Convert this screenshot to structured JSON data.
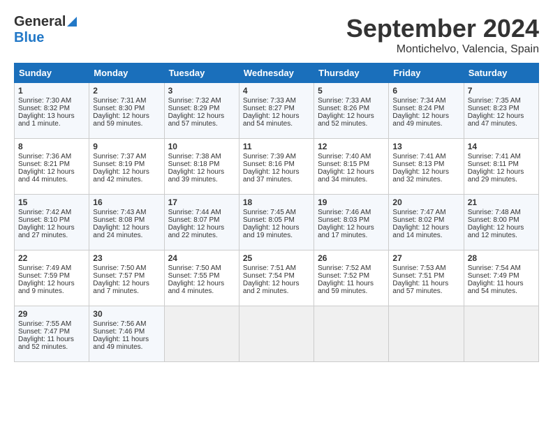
{
  "header": {
    "logo_general": "General",
    "logo_blue": "Blue",
    "month": "September 2024",
    "location": "Montichelvo, Valencia, Spain"
  },
  "weekdays": [
    "Sunday",
    "Monday",
    "Tuesday",
    "Wednesday",
    "Thursday",
    "Friday",
    "Saturday"
  ],
  "weeks": [
    [
      {
        "day": "1",
        "lines": [
          "Sunrise: 7:30 AM",
          "Sunset: 8:32 PM",
          "Daylight: 13 hours",
          "and 1 minute."
        ]
      },
      {
        "day": "2",
        "lines": [
          "Sunrise: 7:31 AM",
          "Sunset: 8:30 PM",
          "Daylight: 12 hours",
          "and 59 minutes."
        ]
      },
      {
        "day": "3",
        "lines": [
          "Sunrise: 7:32 AM",
          "Sunset: 8:29 PM",
          "Daylight: 12 hours",
          "and 57 minutes."
        ]
      },
      {
        "day": "4",
        "lines": [
          "Sunrise: 7:33 AM",
          "Sunset: 8:27 PM",
          "Daylight: 12 hours",
          "and 54 minutes."
        ]
      },
      {
        "day": "5",
        "lines": [
          "Sunrise: 7:33 AM",
          "Sunset: 8:26 PM",
          "Daylight: 12 hours",
          "and 52 minutes."
        ]
      },
      {
        "day": "6",
        "lines": [
          "Sunrise: 7:34 AM",
          "Sunset: 8:24 PM",
          "Daylight: 12 hours",
          "and 49 minutes."
        ]
      },
      {
        "day": "7",
        "lines": [
          "Sunrise: 7:35 AM",
          "Sunset: 8:23 PM",
          "Daylight: 12 hours",
          "and 47 minutes."
        ]
      }
    ],
    [
      {
        "day": "8",
        "lines": [
          "Sunrise: 7:36 AM",
          "Sunset: 8:21 PM",
          "Daylight: 12 hours",
          "and 44 minutes."
        ]
      },
      {
        "day": "9",
        "lines": [
          "Sunrise: 7:37 AM",
          "Sunset: 8:19 PM",
          "Daylight: 12 hours",
          "and 42 minutes."
        ]
      },
      {
        "day": "10",
        "lines": [
          "Sunrise: 7:38 AM",
          "Sunset: 8:18 PM",
          "Daylight: 12 hours",
          "and 39 minutes."
        ]
      },
      {
        "day": "11",
        "lines": [
          "Sunrise: 7:39 AM",
          "Sunset: 8:16 PM",
          "Daylight: 12 hours",
          "and 37 minutes."
        ]
      },
      {
        "day": "12",
        "lines": [
          "Sunrise: 7:40 AM",
          "Sunset: 8:15 PM",
          "Daylight: 12 hours",
          "and 34 minutes."
        ]
      },
      {
        "day": "13",
        "lines": [
          "Sunrise: 7:41 AM",
          "Sunset: 8:13 PM",
          "Daylight: 12 hours",
          "and 32 minutes."
        ]
      },
      {
        "day": "14",
        "lines": [
          "Sunrise: 7:41 AM",
          "Sunset: 8:11 PM",
          "Daylight: 12 hours",
          "and 29 minutes."
        ]
      }
    ],
    [
      {
        "day": "15",
        "lines": [
          "Sunrise: 7:42 AM",
          "Sunset: 8:10 PM",
          "Daylight: 12 hours",
          "and 27 minutes."
        ]
      },
      {
        "day": "16",
        "lines": [
          "Sunrise: 7:43 AM",
          "Sunset: 8:08 PM",
          "Daylight: 12 hours",
          "and 24 minutes."
        ]
      },
      {
        "day": "17",
        "lines": [
          "Sunrise: 7:44 AM",
          "Sunset: 8:07 PM",
          "Daylight: 12 hours",
          "and 22 minutes."
        ]
      },
      {
        "day": "18",
        "lines": [
          "Sunrise: 7:45 AM",
          "Sunset: 8:05 PM",
          "Daylight: 12 hours",
          "and 19 minutes."
        ]
      },
      {
        "day": "19",
        "lines": [
          "Sunrise: 7:46 AM",
          "Sunset: 8:03 PM",
          "Daylight: 12 hours",
          "and 17 minutes."
        ]
      },
      {
        "day": "20",
        "lines": [
          "Sunrise: 7:47 AM",
          "Sunset: 8:02 PM",
          "Daylight: 12 hours",
          "and 14 minutes."
        ]
      },
      {
        "day": "21",
        "lines": [
          "Sunrise: 7:48 AM",
          "Sunset: 8:00 PM",
          "Daylight: 12 hours",
          "and 12 minutes."
        ]
      }
    ],
    [
      {
        "day": "22",
        "lines": [
          "Sunrise: 7:49 AM",
          "Sunset: 7:59 PM",
          "Daylight: 12 hours",
          "and 9 minutes."
        ]
      },
      {
        "day": "23",
        "lines": [
          "Sunrise: 7:50 AM",
          "Sunset: 7:57 PM",
          "Daylight: 12 hours",
          "and 7 minutes."
        ]
      },
      {
        "day": "24",
        "lines": [
          "Sunrise: 7:50 AM",
          "Sunset: 7:55 PM",
          "Daylight: 12 hours",
          "and 4 minutes."
        ]
      },
      {
        "day": "25",
        "lines": [
          "Sunrise: 7:51 AM",
          "Sunset: 7:54 PM",
          "Daylight: 12 hours",
          "and 2 minutes."
        ]
      },
      {
        "day": "26",
        "lines": [
          "Sunrise: 7:52 AM",
          "Sunset: 7:52 PM",
          "Daylight: 11 hours",
          "and 59 minutes."
        ]
      },
      {
        "day": "27",
        "lines": [
          "Sunrise: 7:53 AM",
          "Sunset: 7:51 PM",
          "Daylight: 11 hours",
          "and 57 minutes."
        ]
      },
      {
        "day": "28",
        "lines": [
          "Sunrise: 7:54 AM",
          "Sunset: 7:49 PM",
          "Daylight: 11 hours",
          "and 54 minutes."
        ]
      }
    ],
    [
      {
        "day": "29",
        "lines": [
          "Sunrise: 7:55 AM",
          "Sunset: 7:47 PM",
          "Daylight: 11 hours",
          "and 52 minutes."
        ]
      },
      {
        "day": "30",
        "lines": [
          "Sunrise: 7:56 AM",
          "Sunset: 7:46 PM",
          "Daylight: 11 hours",
          "and 49 minutes."
        ]
      },
      {
        "day": "",
        "lines": []
      },
      {
        "day": "",
        "lines": []
      },
      {
        "day": "",
        "lines": []
      },
      {
        "day": "",
        "lines": []
      },
      {
        "day": "",
        "lines": []
      }
    ]
  ]
}
